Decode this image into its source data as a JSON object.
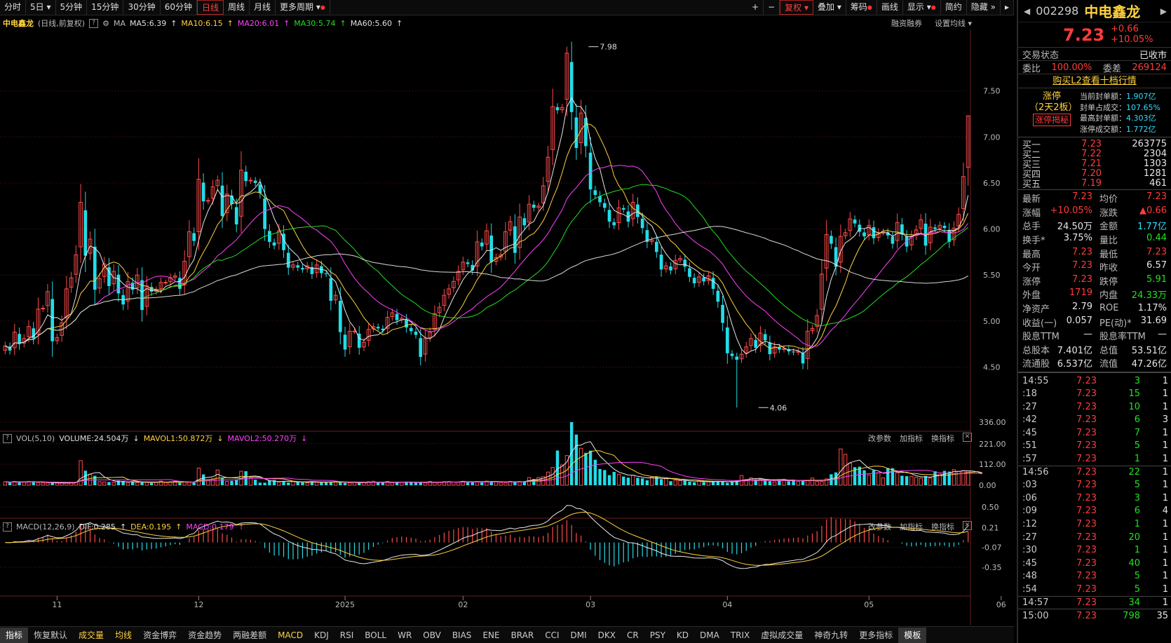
{
  "period_tabs": [
    "分时",
    "5日",
    "5分钟",
    "15分钟",
    "30分钟",
    "60分钟",
    "日线",
    "周线",
    "月线",
    "更多周期"
  ],
  "active_tab": "日线",
  "toolbar_right": [
    "+",
    "−",
    "复权",
    "叠加",
    "筹码",
    "画线",
    "显示",
    "简约",
    "隐藏"
  ],
  "info": {
    "name": "中电鑫龙",
    "mode": "(日线,前复权)",
    "ma_label": "MA",
    "ma5": "MA5:6.39",
    "ma10": "MA10:6.15",
    "ma20": "MA20:6.01",
    "ma30": "MA30:5.74",
    "ma60": "MA60:5.60",
    "right": [
      "融资融券",
      "设置均线"
    ]
  },
  "vol_bar": {
    "label": "VOL(5,10)",
    "volume": "VOLUME:24.504万",
    "mavol1": "MAVOL1:50.872万",
    "mavol2": "MAVOL2:50.270万",
    "right": [
      "改参数",
      "加指标",
      "换指标"
    ]
  },
  "macd_bar": {
    "label": "MACD(12,26,9)",
    "dif": "DIF:0.285",
    "dea": "DEA:0.195",
    "macd": "MACD:0.179",
    "right": [
      "改参数",
      "加指标",
      "换指标"
    ]
  },
  "bottom_tabs": [
    "指标",
    "恢复默认",
    "成交量",
    "均线",
    "资金博弈",
    "资金趋势",
    "两融差额",
    "MACD",
    "KDJ",
    "RSI",
    "BOLL",
    "WR",
    "OBV",
    "BIAS",
    "ENE",
    "BRAR",
    "CCI",
    "DMI",
    "DKX",
    "CR",
    "PSY",
    "KD",
    "DMA",
    "TRIX",
    "虚拟成交量",
    "神奇九转",
    "更多指标",
    "模板"
  ],
  "chart_data": {
    "type": "candlestick",
    "title": "中电鑫龙",
    "price_ylim": [
      4.1,
      8.0
    ],
    "price_ticks": [
      "7.50",
      "7.00",
      "6.50",
      "6.00",
      "5.50",
      "5.00",
      "4.50"
    ],
    "vol_ylim": [
      0,
      336
    ],
    "vol_ticks": [
      "336.00",
      "221.00",
      "112.00",
      "0.00"
    ],
    "macd_ylim": [
      -0.38,
      0.53
    ],
    "macd_ticks": [
      "0.50",
      "0.21",
      "-0.07",
      "-0.35"
    ],
    "x_labels": [
      "11",
      "12",
      "2025",
      "02",
      "03",
      "04",
      "05",
      "06"
    ],
    "x_label_idx": [
      11,
      41,
      72,
      97,
      124,
      153,
      183,
      211
    ],
    "annotations": [
      {
        "idx": 123,
        "text": "7.98",
        "value": 7.98
      },
      {
        "idx": 159,
        "text": "4.06",
        "value": 4.06
      }
    ],
    "close": [
      4.73,
      4.68,
      4.88,
      4.75,
      4.81,
      4.94,
      4.81,
      5.13,
      5.14,
      5.32,
      4.78,
      4.82,
      4.98,
      5.35,
      5.47,
      5.72,
      6.29,
      5.71,
      5.89,
      5.34,
      5.46,
      5.62,
      5.38,
      5.54,
      5.3,
      5.18,
      5.43,
      5.34,
      5.5,
      5.12,
      5.38,
      5.32,
      5.34,
      5.42,
      5.42,
      5.47,
      5.49,
      5.35,
      5.65,
      5.97,
      5.87,
      6.54,
      6.3,
      6.31,
      6.46,
      6.53,
      6.14,
      6.38,
      6.27,
      6.05,
      6.64,
      6.52,
      6.53,
      6.5,
      6.39,
      6.0,
      5.86,
      5.82,
      5.98,
      5.77,
      5.58,
      5.61,
      5.58,
      5.56,
      5.6,
      5.51,
      5.61,
      5.52,
      5.51,
      5.22,
      5.28,
      4.88,
      4.69,
      4.89,
      4.89,
      4.71,
      4.77,
      4.91,
      4.94,
      4.92,
      4.9,
      5.04,
      5.09,
      5.01,
      5.03,
      4.93,
      4.89,
      4.85,
      4.61,
      4.81,
      4.88,
      5.08,
      5.15,
      5.28,
      5.35,
      5.43,
      5.54,
      5.64,
      5.62,
      5.55,
      5.86,
      5.81,
      5.98,
      5.64,
      5.69,
      5.72,
      5.97,
      6.08,
      5.74,
      6.13,
      6.04,
      6.27,
      6.23,
      6.25,
      6.47,
      6.78,
      7.33,
      7.29,
      7.32,
      7.91,
      7.27,
      6.88,
      7.26,
      6.9,
      6.43,
      6.37,
      6.29,
      6.23,
      6.08,
      6.04,
      6.23,
      6.21,
      6.08,
      6.29,
      6.13,
      6.01,
      5.86,
      5.88,
      5.75,
      5.56,
      5.6,
      5.55,
      5.66,
      5.68,
      5.59,
      5.48,
      5.41,
      5.48,
      5.43,
      5.49,
      5.35,
      5.21,
      4.98,
      4.65,
      4.62,
      4.58,
      4.64,
      4.72,
      4.81,
      4.71,
      4.87,
      4.79,
      4.64,
      4.72,
      4.69,
      4.7,
      4.67,
      4.66,
      4.67,
      4.54,
      4.89,
      4.92,
      5.06,
      5.51,
      5.94,
      5.84,
      5.59,
      5.92,
      5.96,
      6.11,
      6.06,
      5.97,
      5.92,
      6.04,
      5.9,
      5.96,
      5.97,
      5.93,
      5.84,
      6.07,
      5.94,
      5.81,
      5.92,
      5.99,
      6.1,
      5.82,
      6.02,
      6.0,
      6.04,
      6.01,
      5.86,
      6.01,
      6.16,
      6.57,
      7.23
    ],
    "volume": [
      18.7,
      14.8,
      20.2,
      20.0,
      15.9,
      20.8,
      20.1,
      14.5,
      12.2,
      12.2,
      12.6,
      11.7,
      12.5,
      12.1,
      13.2,
      15.9,
      130.9,
      77.3,
      58.7,
      50.3,
      19.0,
      17.5,
      17.0,
      16.0,
      24.5,
      22.4,
      12.4,
      18.5,
      14.1,
      18.6,
      16.3,
      13.1,
      15.5,
      21.6,
      14.7,
      18.8,
      20.7,
      14.1,
      17.5,
      15.8,
      14.5,
      91.1,
      57.6,
      29.2,
      34.3,
      81.0,
      37.1,
      20.6,
      23.8,
      28.5,
      74.3,
      74.6,
      38.5,
      29.4,
      13.7,
      13.4,
      26.4,
      27.3,
      15.6,
      21.5,
      14.5,
      20.7,
      16.9,
      15.4,
      12.1,
      21.2,
      17.2,
      17.0,
      14.6,
      17.5,
      19.4,
      16.6,
      12.1,
      13.4,
      15.2,
      12.2,
      15.6,
      19.2,
      21.2,
      14.1,
      13.6,
      20.2,
      13.8,
      18.5,
      16.4,
      16.3,
      17.7,
      13.8,
      17.5,
      13.2,
      20.4,
      14.6,
      15.2,
      19.7,
      19.8,
      16.7,
      15.7,
      20.9,
      19.6,
      19.8,
      19.7,
      14.8,
      21.8,
      21.2,
      20.0,
      15.2,
      12.5,
      20.7,
      20.6,
      20.5,
      21.8,
      40.5,
      33.1,
      41.7,
      45.2,
      70.2,
      94.8,
      184.6,
      108.2,
      158.2,
      336.0,
      269.7,
      197.0,
      172.6,
      184.1,
      135.5,
      86.5,
      80.8,
      53.8,
      71.1,
      58.6,
      46.3,
      40.2,
      53.3,
      39.4,
      36.6,
      26.2,
      41.7,
      45.1,
      31.9,
      34.6,
      21.5,
      25.7,
      24.3,
      26.1,
      18.8,
      15.7,
      22.8,
      17.2,
      18.8,
      20.9,
      19.9,
      22.2,
      13.4,
      20.2,
      25.0,
      51.5,
      30.5,
      39.1,
      31.0,
      33.1,
      24.5,
      21.7,
      17.6,
      27.3,
      31.5,
      20.6,
      29.6,
      21.1,
      23.1,
      25.9,
      38.5,
      20.1,
      20.7,
      33.6,
      58.3,
      68.3,
      193.1,
      164.5,
      117.8,
      96.1,
      98.8,
      79.6,
      54.9,
      79.4,
      66.5,
      39.2,
      91.7,
      90.8,
      66.3,
      50.7,
      48.1,
      47.7,
      42.0,
      38.0,
      48.9,
      38.9,
      74.2,
      59.3,
      76.5,
      72.6,
      82.9,
      74.2,
      78.2,
      76.1,
      63.2,
      65.6,
      24.5
    ]
  }
}
